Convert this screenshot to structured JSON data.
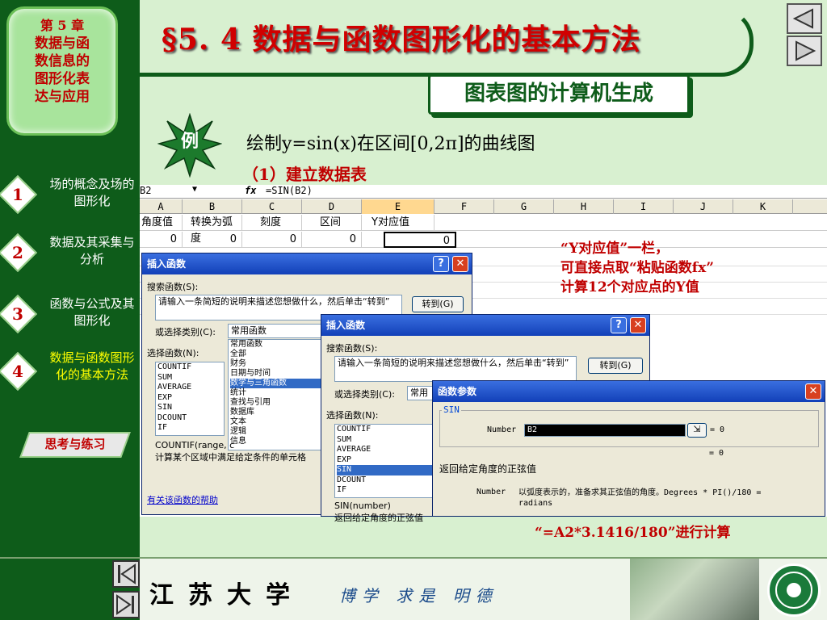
{
  "sidebar": {
    "chapter": [
      "第 5 章",
      "数据与函",
      "数信息的",
      "图形化表",
      "达与应用"
    ],
    "items": [
      {
        "num": "1",
        "label": "场的概念及场的图形化"
      },
      {
        "num": "2",
        "label": "数据及其采集与分析"
      },
      {
        "num": "3",
        "label": "函数与公式及其图形化"
      },
      {
        "num": "4",
        "label": "数据与函数图形化的基本方法"
      }
    ],
    "think_label": "思考与练习"
  },
  "header": {
    "title": "§5. 4 数据与函数图形化的基本方法",
    "subtitle": "图表图的计算机生成"
  },
  "example": {
    "badge": "例",
    "text": "绘制y=sin(x)在区间[0,2π]的曲线图",
    "step": "（1）建立数据表"
  },
  "sheet": {
    "cell_ref": "B2",
    "fx": "fx",
    "formula": "=SIN(B2)",
    "columns": [
      "A",
      "B",
      "C",
      "D",
      "E",
      "F",
      "G",
      "H",
      "I",
      "J",
      "K"
    ],
    "headers": [
      "角度值",
      "转换为弧度",
      "刻度",
      "区间",
      "Y对应值"
    ],
    "values": [
      "0",
      "0",
      "0",
      "0",
      "0"
    ]
  },
  "dialog1": {
    "title": "插入函数",
    "search_label": "搜索函数(S):",
    "search_text": "请输入一条简短的说明来描述您想做什么，然后单击“转到”",
    "goto_label": "转到(G)",
    "category_label": "或选择类别(C):",
    "category_value": "常用函数",
    "select_label": "选择函数(N):",
    "functions": [
      "COUNTIF",
      "SUM",
      "AVERAGE",
      "EXP",
      "SIN",
      "DCOUNT",
      "IF"
    ],
    "categories": [
      "常用函数",
      "全部",
      "财务",
      "日期与时间",
      "数学与三角函数",
      "统计",
      "查找与引用",
      "数据库",
      "文本",
      "逻辑",
      "信息"
    ],
    "selected_category": "数学与三角函数",
    "syntax": "COUNTIF(range, c",
    "desc": "计算某个区域中满足给定条件的单元格",
    "help": "有关该函数的帮助"
  },
  "dialog2": {
    "title": "插入函数",
    "search_label": "搜索函数(S):",
    "search_text": "请输入一条简短的说明来描述您想做什么，然后单击“转到”",
    "goto_label": "转到(G)",
    "category_label": "或选择类别(C):",
    "category_value": "常用",
    "select_label": "选择函数(N):",
    "functions": [
      "COUNTIF",
      "SUM",
      "AVERAGE",
      "EXP",
      "SIN",
      "DCOUNT",
      "IF"
    ],
    "selected_function": "SIN",
    "syntax": "SIN(number)",
    "desc": "返回给定角度的正弦值"
  },
  "dialog3": {
    "title": "函数参数",
    "fn": "SIN",
    "arg_label": "Number",
    "arg_value": "B2",
    "arg_result": "= 0",
    "result": "= 0",
    "desc": "返回给定角度的正弦值",
    "arg_desc_label": "Number",
    "arg_desc": "以弧度表示的，准备求其正弦值的角度。Degrees * PI()/180 = radians"
  },
  "annotations": {
    "line1": "“Y对应值”一栏，",
    "line2": "可直接点取“粘贴函数fx”",
    "line3": "计算12个对应点的Y值",
    "formula_note": "“=A2*3.1416/180”进行计算"
  },
  "footer": {
    "university": "江苏大学",
    "motto": "博学 求是 明德"
  },
  "colors": {
    "dark_green": "#0e5c1a",
    "title_red": "#d00000",
    "background": "#d8f0d0"
  }
}
